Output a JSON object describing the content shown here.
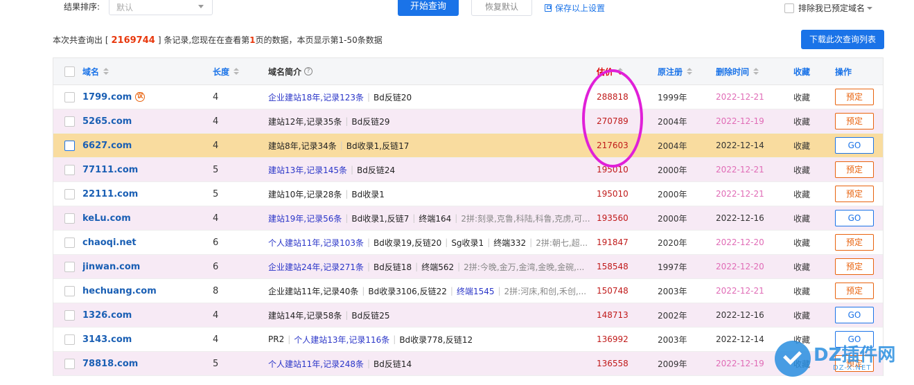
{
  "topbar": {
    "sort_label": "结果排序:",
    "sort_value": "默认",
    "query_button": "开始查询",
    "reset_button": "恢复默认",
    "save_settings": "保存以上设置",
    "exclude_label": "排除我已预定域名"
  },
  "summary": {
    "prefix": "本次共查询出 [",
    "total": "2169744",
    "middle": "] 条记录,您现在在查看第",
    "page": "1",
    "suffix": "页的数据，本页显示第1-50条数据",
    "download_button": "下载此次查询列表"
  },
  "headers": {
    "domain": "域名",
    "length": "长度",
    "desc": "域名简介",
    "price": "估价",
    "registered": "原注册",
    "deleted": "删除时间",
    "favorite": "收藏",
    "action": "操作"
  },
  "rows": [
    {
      "domain": "1799.com",
      "bargain": "议",
      "length": "4",
      "desc": [
        {
          "t": "企业建站18年,记录123条",
          "s": "link"
        },
        {
          "t": "Bd反链20",
          "s": "mixed"
        }
      ],
      "price": "288818",
      "reg": "1999年",
      "del": "2022-12-21",
      "del_color": "pink",
      "fav": "收藏",
      "action": "预定",
      "style": "white"
    },
    {
      "domain": "5265.com",
      "length": "4",
      "desc": [
        {
          "t": "建站12年,记录35条",
          "s": "plain"
        },
        {
          "t": "Bd反链29",
          "s": "mixed"
        }
      ],
      "price": "270789",
      "reg": "2004年",
      "del": "2022-12-19",
      "del_color": "pink",
      "fav": "收藏",
      "action": "预定",
      "style": "alt"
    },
    {
      "domain": "6627.com",
      "length": "4",
      "desc": [
        {
          "t": "建站8年,记录34条",
          "s": "plain"
        },
        {
          "t": "Bd收录1,反链17",
          "s": "mixed"
        }
      ],
      "price": "217603",
      "reg": "2004年",
      "del": "2022-12-14",
      "del_color": "dark",
      "fav": "收藏",
      "action": "GO",
      "style": "hl"
    },
    {
      "domain": "77111.com",
      "length": "5",
      "desc": [
        {
          "t": "建站13年,记录145条",
          "s": "link"
        },
        {
          "t": "Bd反链24",
          "s": "mixed"
        }
      ],
      "price": "195010",
      "reg": "2000年",
      "del": "2022-12-21",
      "del_color": "pink",
      "fav": "收藏",
      "action": "预定",
      "style": "alt"
    },
    {
      "domain": "22111.com",
      "length": "5",
      "desc": [
        {
          "t": "建站10年,记录28条",
          "s": "plain"
        },
        {
          "t": "Bd收录1",
          "s": "plain"
        }
      ],
      "price": "195010",
      "reg": "2000年",
      "del": "2022-12-21",
      "del_color": "pink",
      "fav": "收藏",
      "action": "预定",
      "style": "white"
    },
    {
      "domain": "keLu.com",
      "length": "4",
      "desc": [
        {
          "t": "建站19年,记录56条",
          "s": "link"
        },
        {
          "t": "Bd收录1,反链7",
          "s": "plain"
        },
        {
          "t": "终端164",
          "s": "plain"
        },
        {
          "t": "2拼:刻录,克鲁,科陆,科鲁,克虏,可...",
          "s": "grey"
        }
      ],
      "price": "193560",
      "reg": "2000年",
      "del": "2022-12-16",
      "del_color": "dark",
      "fav": "收藏",
      "action": "GO",
      "style": "alt"
    },
    {
      "domain": "chaoqi.net",
      "length": "6",
      "desc": [
        {
          "t": "个人建站11年,记录103条",
          "s": "link"
        },
        {
          "t": "Bd收录19,反链20",
          "s": "mixed"
        },
        {
          "t": "Sg收录1",
          "s": "plain"
        },
        {
          "t": "终端332",
          "s": "plain"
        },
        {
          "t": "2拼:朝七,超...",
          "s": "grey"
        }
      ],
      "price": "191847",
      "reg": "2020年",
      "del": "2022-12-20",
      "del_color": "pink",
      "fav": "收藏",
      "action": "预定",
      "style": "white"
    },
    {
      "domain": "jinwan.com",
      "length": "6",
      "desc": [
        {
          "t": "企业建站24年,记录271条",
          "s": "link"
        },
        {
          "t": "Bd反链18",
          "s": "mixed"
        },
        {
          "t": "终端562",
          "s": "plain"
        },
        {
          "t": "2拼:今晚,金万,金湾,金晚,金碗,...",
          "s": "grey"
        }
      ],
      "price": "158548",
      "reg": "1997年",
      "del": "2022-12-20",
      "del_color": "pink",
      "fav": "收藏",
      "action": "预定",
      "style": "alt"
    },
    {
      "domain": "hechuang.com",
      "length": "8",
      "desc": [
        {
          "t": "企业建站11年,记录40条",
          "s": "plain"
        },
        {
          "t": "Bd收录3106,反链22",
          "s": "mixed"
        },
        {
          "t": "终端1545",
          "s": "link"
        },
        {
          "t": "2拼:河床,和创,禾创,...",
          "s": "grey"
        }
      ],
      "price": "150748",
      "reg": "2003年",
      "del": "2022-12-21",
      "del_color": "pink",
      "fav": "收藏",
      "action": "预定",
      "style": "white"
    },
    {
      "domain": "1326.com",
      "length": "4",
      "desc": [
        {
          "t": "建站14年,记录58条",
          "s": "plain"
        },
        {
          "t": "Bd反链25",
          "s": "mixed"
        }
      ],
      "price": "148713",
      "reg": "2002年",
      "del": "2022-12-16",
      "del_color": "dark",
      "fav": "收藏",
      "action": "GO",
      "style": "alt"
    },
    {
      "domain": "3143.com",
      "length": "4",
      "desc": [
        {
          "t": "PR2",
          "s": "plain"
        },
        {
          "t": "个人建站13年,记录116条",
          "s": "link"
        },
        {
          "t": "Bd收录778,反链12",
          "s": "mixed"
        }
      ],
      "price": "136992",
      "reg": "2003年",
      "del": "2022-12-14",
      "del_color": "dark",
      "fav": "收藏",
      "action": "GO",
      "style": "white"
    },
    {
      "domain": "78818.com",
      "length": "5",
      "desc": [
        {
          "t": "个人建站11年,记录248条",
          "s": "link"
        },
        {
          "t": "Bd反链14",
          "s": "mixed"
        }
      ],
      "price": "136558",
      "reg": "2009年",
      "del": "2022-12-19",
      "del_color": "pink",
      "fav": "收藏",
      "action": "预定",
      "style": "alt"
    }
  ],
  "watermark": {
    "main": "DZ插件网",
    "sub": "DZ-X.NET"
  },
  "colors": {
    "accent": "#1a73e8",
    "price": "#c01a1a",
    "highlight_row": "#f9dc9f",
    "alt_row": "#f7eaf5",
    "annotation": "#e020d8"
  }
}
